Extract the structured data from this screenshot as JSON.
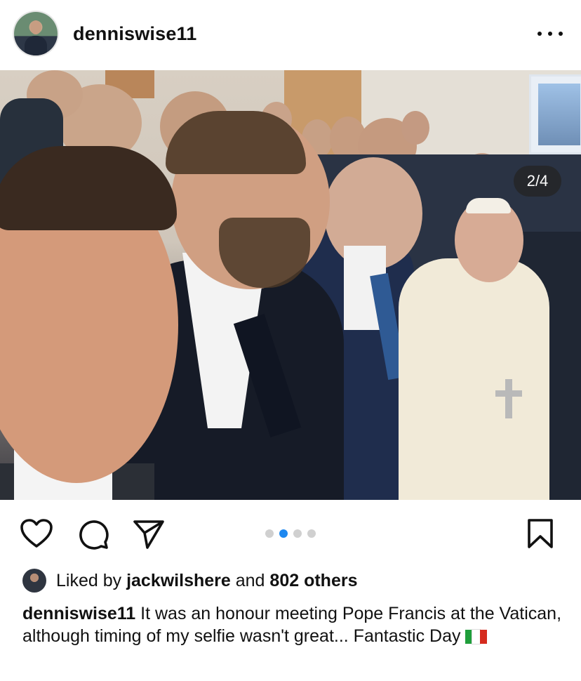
{
  "post": {
    "username": "denniswise11",
    "more_icon": "more-horizontal-icon"
  },
  "photo": {
    "counter": "2/4",
    "alt_subject": "group selfie"
  },
  "actions": {
    "like_icon": "heart-icon",
    "comment_icon": "comment-icon",
    "share_icon": "send-icon",
    "save_icon": "bookmark-icon",
    "carousel_total": 4,
    "carousel_active": 2
  },
  "likes": {
    "prefix": "Liked by",
    "user": "jackwilshere",
    "middle": "and",
    "count": "802 others"
  },
  "caption": {
    "username": "denniswise11",
    "text": "It was an honour meeting Pope Francis at the Vatican, although timing of my selfie wasn't great... Fantastic Day",
    "flag": "Italy flag emoji",
    "flag_colors": [
      "#1f9e3b",
      "#ffffff",
      "#d52b1e"
    ]
  },
  "colors": {
    "accent": "#1e88f0",
    "text": "#111111",
    "counter_bg": "#242424"
  }
}
